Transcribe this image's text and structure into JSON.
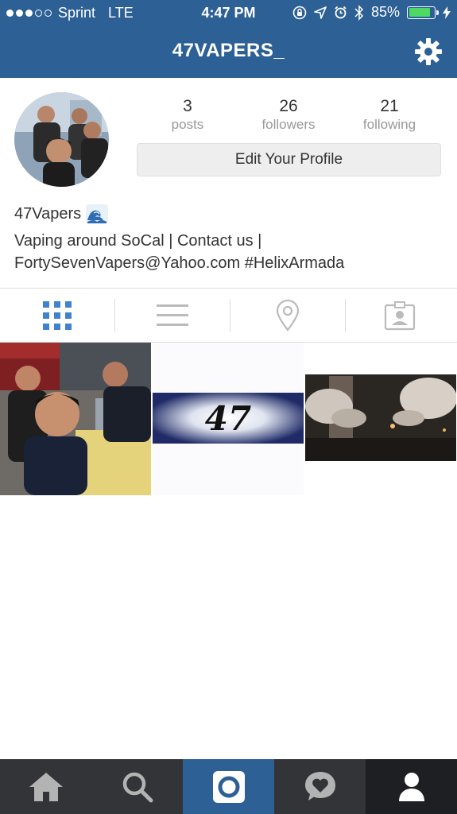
{
  "status_bar": {
    "carrier": "Sprint",
    "network": "LTE",
    "time": "4:47 PM",
    "battery": "85%",
    "battery_level": 0.85,
    "signal_bars_filled": 3,
    "signal_bars_total": 5
  },
  "nav": {
    "title": "47VAPERS_",
    "settings_icon": "gear-icon"
  },
  "profile": {
    "stats": [
      {
        "value": "3",
        "label": "posts"
      },
      {
        "value": "26",
        "label": "followers"
      },
      {
        "value": "21",
        "label": "following"
      }
    ],
    "edit_button": "Edit Your Profile",
    "display_name": "47Vapers",
    "bio_line1": "Vaping around SoCal | Contact us |",
    "bio_line2": "FortySevenVapers@Yahoo.com #HelixArmada"
  },
  "view_tabs": [
    {
      "icon": "grid-icon",
      "active": true
    },
    {
      "icon": "list-icon",
      "active": false
    },
    {
      "icon": "location-pin-icon",
      "active": false
    },
    {
      "icon": "tagged-photos-icon",
      "active": false
    }
  ],
  "posts": [
    {
      "icon": "photo-group-selfie"
    },
    {
      "icon": "photo-47-logo",
      "text": "47"
    },
    {
      "icon": "photo-vapor-clouds"
    }
  ],
  "tab_bar": [
    {
      "icon": "home-icon",
      "active": false
    },
    {
      "icon": "search-icon",
      "active": false
    },
    {
      "icon": "camera-icon",
      "active": true
    },
    {
      "icon": "activity-heart-icon",
      "active": false
    },
    {
      "icon": "profile-icon",
      "active": false
    }
  ],
  "colors": {
    "brand_blue": "#2d6095",
    "tab_bar_dark": "#333438",
    "active_tab_icon": "#3f82cd",
    "inactive_tab_icon": "#bbbbbb"
  }
}
